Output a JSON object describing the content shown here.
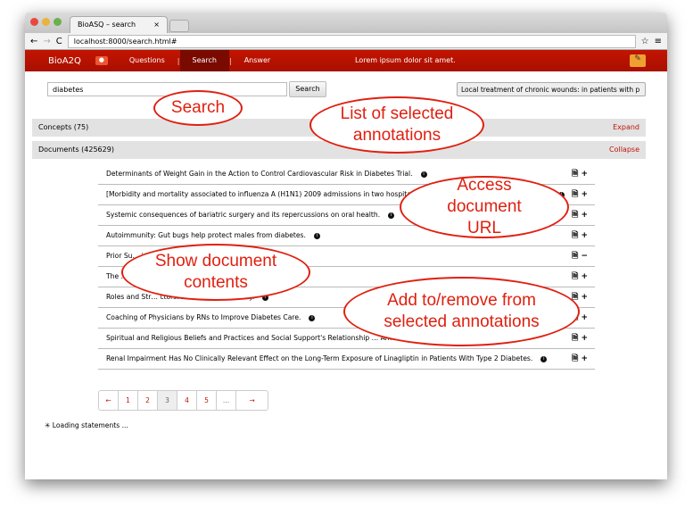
{
  "browser": {
    "tab_title": "BioASQ – search",
    "url": "localhost:8000/search.html#"
  },
  "nav": {
    "logo": "BioA2Q",
    "items": [
      "Questions",
      "Search",
      "Answer"
    ],
    "separator": "|",
    "message": "Lorem ipsum dolor sit amet.",
    "active": "Search"
  },
  "search": {
    "value": "diabetes",
    "button": "Search",
    "selected_annotation": "Local treatment of chronic wounds: in patients with p"
  },
  "concepts": {
    "label": "Concepts (75)",
    "action": "Expand"
  },
  "documents": {
    "label": "Documents (425629)",
    "action": "Collapse",
    "rows": [
      {
        "title": "Determinants of Weight Gain in the Action to Control Cardiovascular Risk in Diabetes Trial.",
        "action": "+"
      },
      {
        "title": "[Morbidity and mortality associated to influenza A (H1N1) 2009 admissions in two hospitals of t… analysis of its economic impact].",
        "action": "+"
      },
      {
        "title": "Systemic consequences of bariatric surgery and its repercussions on oral health.",
        "action": "+"
      },
      {
        "title": "Autoimmunity: Gut bugs help protect males from diabetes.",
        "action": "+"
      },
      {
        "title": "Prior Su… in Patients With Chronic Pancreatitis.",
        "action": "−"
      },
      {
        "title": "The … ypertensive Patients: The AVA-E Study.",
        "action": "+"
      },
      {
        "title": "Roles and Str… ctors: An Exploratory Study.",
        "action": "+"
      },
      {
        "title": "Coaching of Physicians by RNs to Improve Diabetes Care.",
        "action": "+"
      },
      {
        "title": "Spiritual and Religious Beliefs and Practices and Social Support's Relationship … Americans.",
        "action": "+"
      },
      {
        "title": "Renal Impairment Has No Clinically Relevant Effect on the Long-Term Exposure of Linagliptin in Patients With Type 2 Diabetes.",
        "action": "+"
      }
    ]
  },
  "pagination": {
    "prev": "←",
    "pages": [
      "1",
      "2",
      "3",
      "4",
      "5",
      "..."
    ],
    "current": "3",
    "next": "→"
  },
  "loading": "Loading statements ...",
  "callouts": [
    "Search",
    "List of selected annotations",
    "Access document URL",
    "Show document contents",
    "Add to/remove from selected annotations"
  ],
  "colors": {
    "nav": "#b81200",
    "link": "#c0140a",
    "callout": "#e02010"
  }
}
